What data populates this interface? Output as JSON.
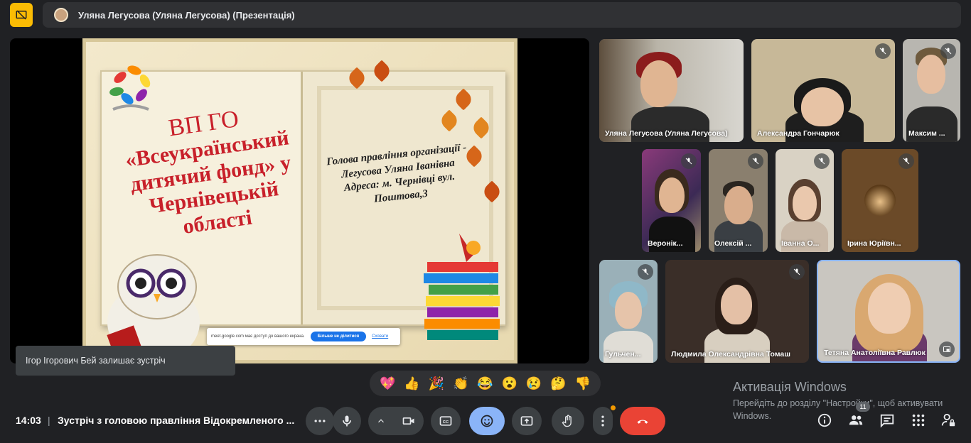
{
  "header": {
    "presenter_title": "Уляна Легусова (Уляна Легусова) (Презентація)"
  },
  "slide": {
    "title_line1": "ВП ГО",
    "title_line2": "«Всеукраїнський дитячий фонд» у Чернівецькій області",
    "info": "Голова правління організації - Легусова Уляна Іванівна Адреса: м. Чернівці вул. Поштова,3",
    "share_notice": "meet.google.com має доступ до вашого екрана.",
    "share_stop_label": "Більше не ділитися",
    "share_hide_label": "Сховати"
  },
  "participants": [
    {
      "name": "Уляна Легусова (Уляна Легусова)"
    },
    {
      "name": "Александра Гончарюк"
    },
    {
      "name": "Максим ..."
    },
    {
      "name": "Веронік..."
    },
    {
      "name": "Олексій ..."
    },
    {
      "name": "Іванна О..."
    },
    {
      "name": "Ірина Юріївн..."
    },
    {
      "name": "Гульчен..."
    },
    {
      "name": "Людмила Олександрівна Томаш"
    },
    {
      "name": "Тетяна Анатоліївна Равлюк"
    }
  ],
  "toast": {
    "text": "Ігор Ігорович Бей залишає зустріч"
  },
  "reactions": [
    "💖",
    "👍",
    "🎉",
    "👏",
    "😂",
    "😮",
    "😢",
    "🤔",
    "👎"
  ],
  "watermark": {
    "title": "Активація Windows",
    "subtitle": "Перейдіть до розділу \"Настройки\", щоб активувати Windows."
  },
  "bottom": {
    "time": "14:03",
    "separator": "|",
    "meeting_name": "Зустріч з головою правління Відокремленого ...",
    "people_count": "11"
  },
  "colors": {
    "background": "#202124",
    "present_badge": "#fbbc04",
    "end_call": "#ea4335",
    "active_control": "#8ab4f8"
  }
}
